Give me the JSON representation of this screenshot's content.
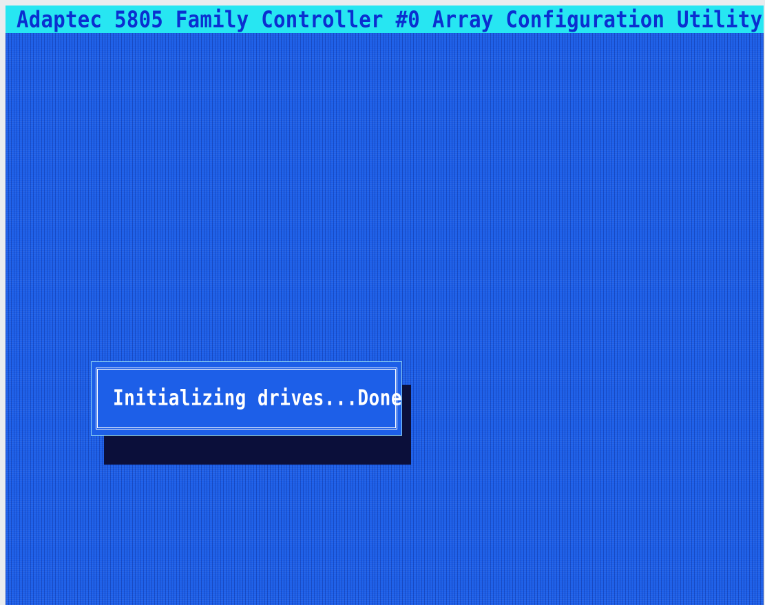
{
  "window": {
    "title": "Adaptec 5805 Family Controller #0 Array Configuration Utility"
  },
  "dialog": {
    "message": "Initializing drives...Done"
  },
  "colors": {
    "background": "#1d5fe8",
    "title_bar": "#27e6f2",
    "title_text": "#0b2fd0",
    "dialog_text": "#ffffff",
    "shadow": "#0b0f3a"
  }
}
